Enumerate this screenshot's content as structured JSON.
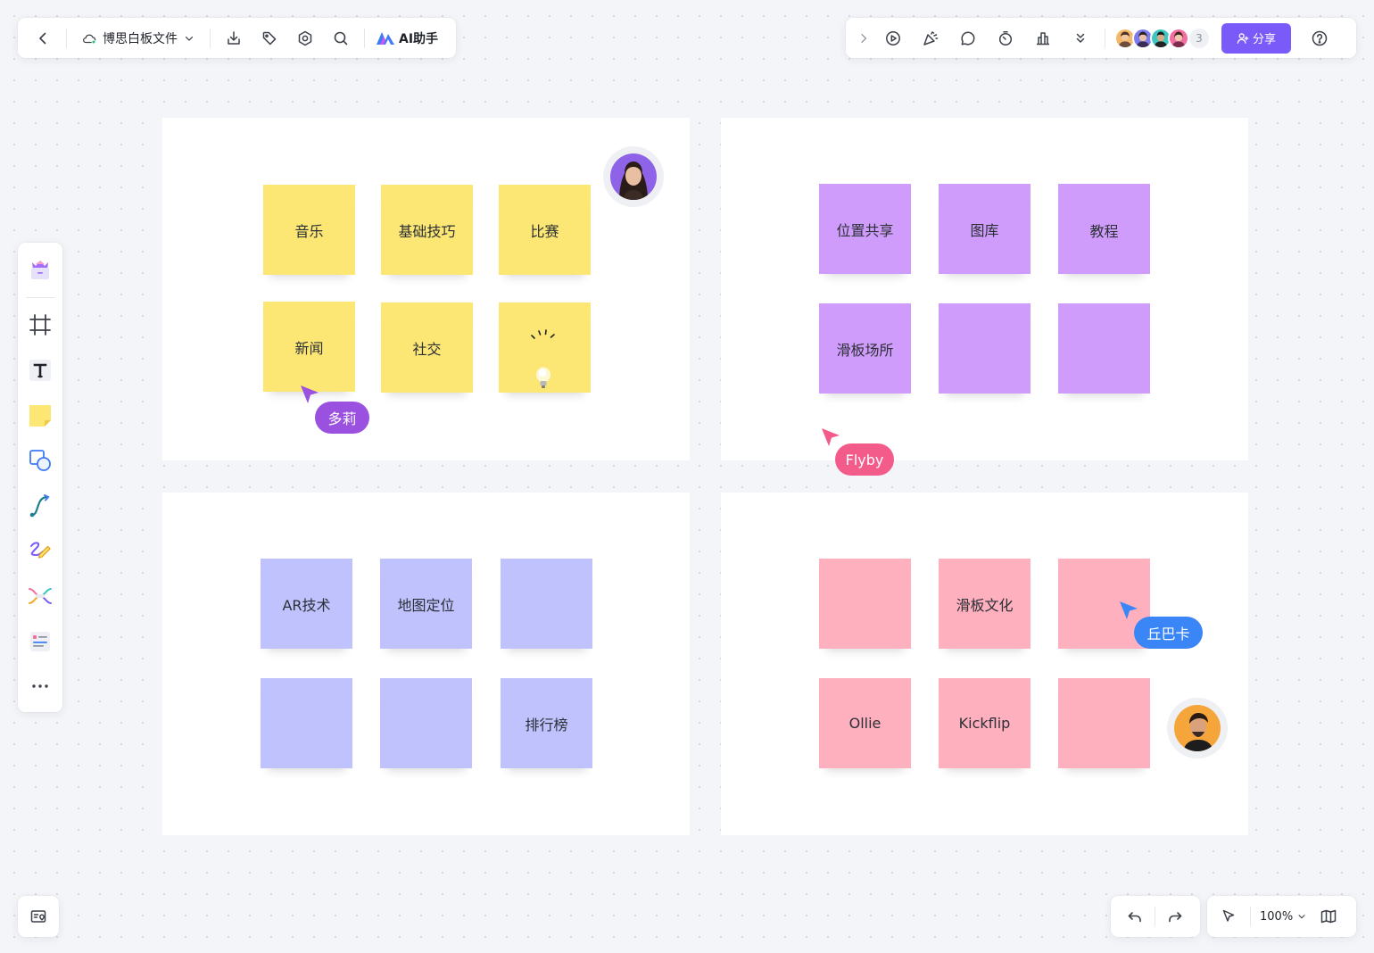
{
  "toolbar": {
    "doc_title": "博思白板文件",
    "ai_label": "AI助手",
    "share_label": "分享",
    "collaborator_count": "3"
  },
  "colors": {
    "accent": "#7a5af8",
    "note_yellow": "#fde774",
    "note_purple": "#cf9cfb",
    "note_blue": "#bfc2fc",
    "note_pink": "#ffb0bf",
    "cursor_purple": "#9b51e0",
    "cursor_pink": "#f35b8a",
    "cursor_blue": "#3b86f6"
  },
  "board": {
    "frame1": {
      "notes": [
        "音乐",
        "基础技巧",
        "比赛",
        "新闻",
        "社交",
        ""
      ]
    },
    "frame2": {
      "notes": [
        "位置共享",
        "图库",
        "教程",
        "滑板场所",
        "",
        ""
      ]
    },
    "frame3": {
      "notes": [
        "AR技术",
        "地图定位",
        "",
        "",
        "",
        "排行榜"
      ]
    },
    "frame4": {
      "notes": [
        "",
        "滑板文化",
        "",
        "Ollie",
        "Kickflip",
        ""
      ]
    }
  },
  "cursors": {
    "user1": "多莉",
    "user2": "Flyby",
    "user3": "丘巴卡"
  },
  "zoom": {
    "level": "100%"
  }
}
